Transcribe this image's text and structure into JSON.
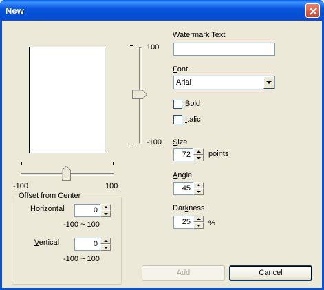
{
  "window": {
    "title": "New"
  },
  "vertical_slider": {
    "max_label": "100",
    "min_label": "-100",
    "value": 0
  },
  "horizontal_slider": {
    "min_label": "-100",
    "max_label": "100",
    "value": 0
  },
  "offset_group": {
    "title": "Offset from Center",
    "horizontal": {
      "label_acc": "H",
      "label_rest": "orizontal",
      "value": "0",
      "range": "-100 ~ 100"
    },
    "vertical": {
      "label_acc": "V",
      "label_rest": "ertical",
      "value": "0",
      "range": "-100 ~ 100"
    }
  },
  "watermark_text": {
    "label_acc": "W",
    "label_rest": "atermark Text",
    "value": ""
  },
  "font": {
    "label_acc": "F",
    "label_rest": "ont",
    "selected": "Arial"
  },
  "bold": {
    "label_acc": "B",
    "label_rest": "old",
    "checked": false
  },
  "italic": {
    "label_acc": "I",
    "label_rest": "talic",
    "checked": false
  },
  "size": {
    "label_acc": "S",
    "label_rest": "ize",
    "value": "72",
    "unit": "points"
  },
  "angle": {
    "label_acc": "A",
    "label_rest": "ngle",
    "value": "45"
  },
  "darkness": {
    "label_pre": "Dar",
    "label_acc": "k",
    "label_rest": "ness",
    "value": "25",
    "unit": "%"
  },
  "buttons": {
    "add": {
      "label_acc": "A",
      "label_rest": "dd",
      "enabled": false
    },
    "cancel": {
      "label_acc": "C",
      "label_rest": "ancel"
    }
  },
  "icons": {
    "close": "close-icon",
    "dropdown": "chevron-down-icon",
    "spin_up": "arrow-up-icon",
    "spin_down": "arrow-down-icon"
  }
}
